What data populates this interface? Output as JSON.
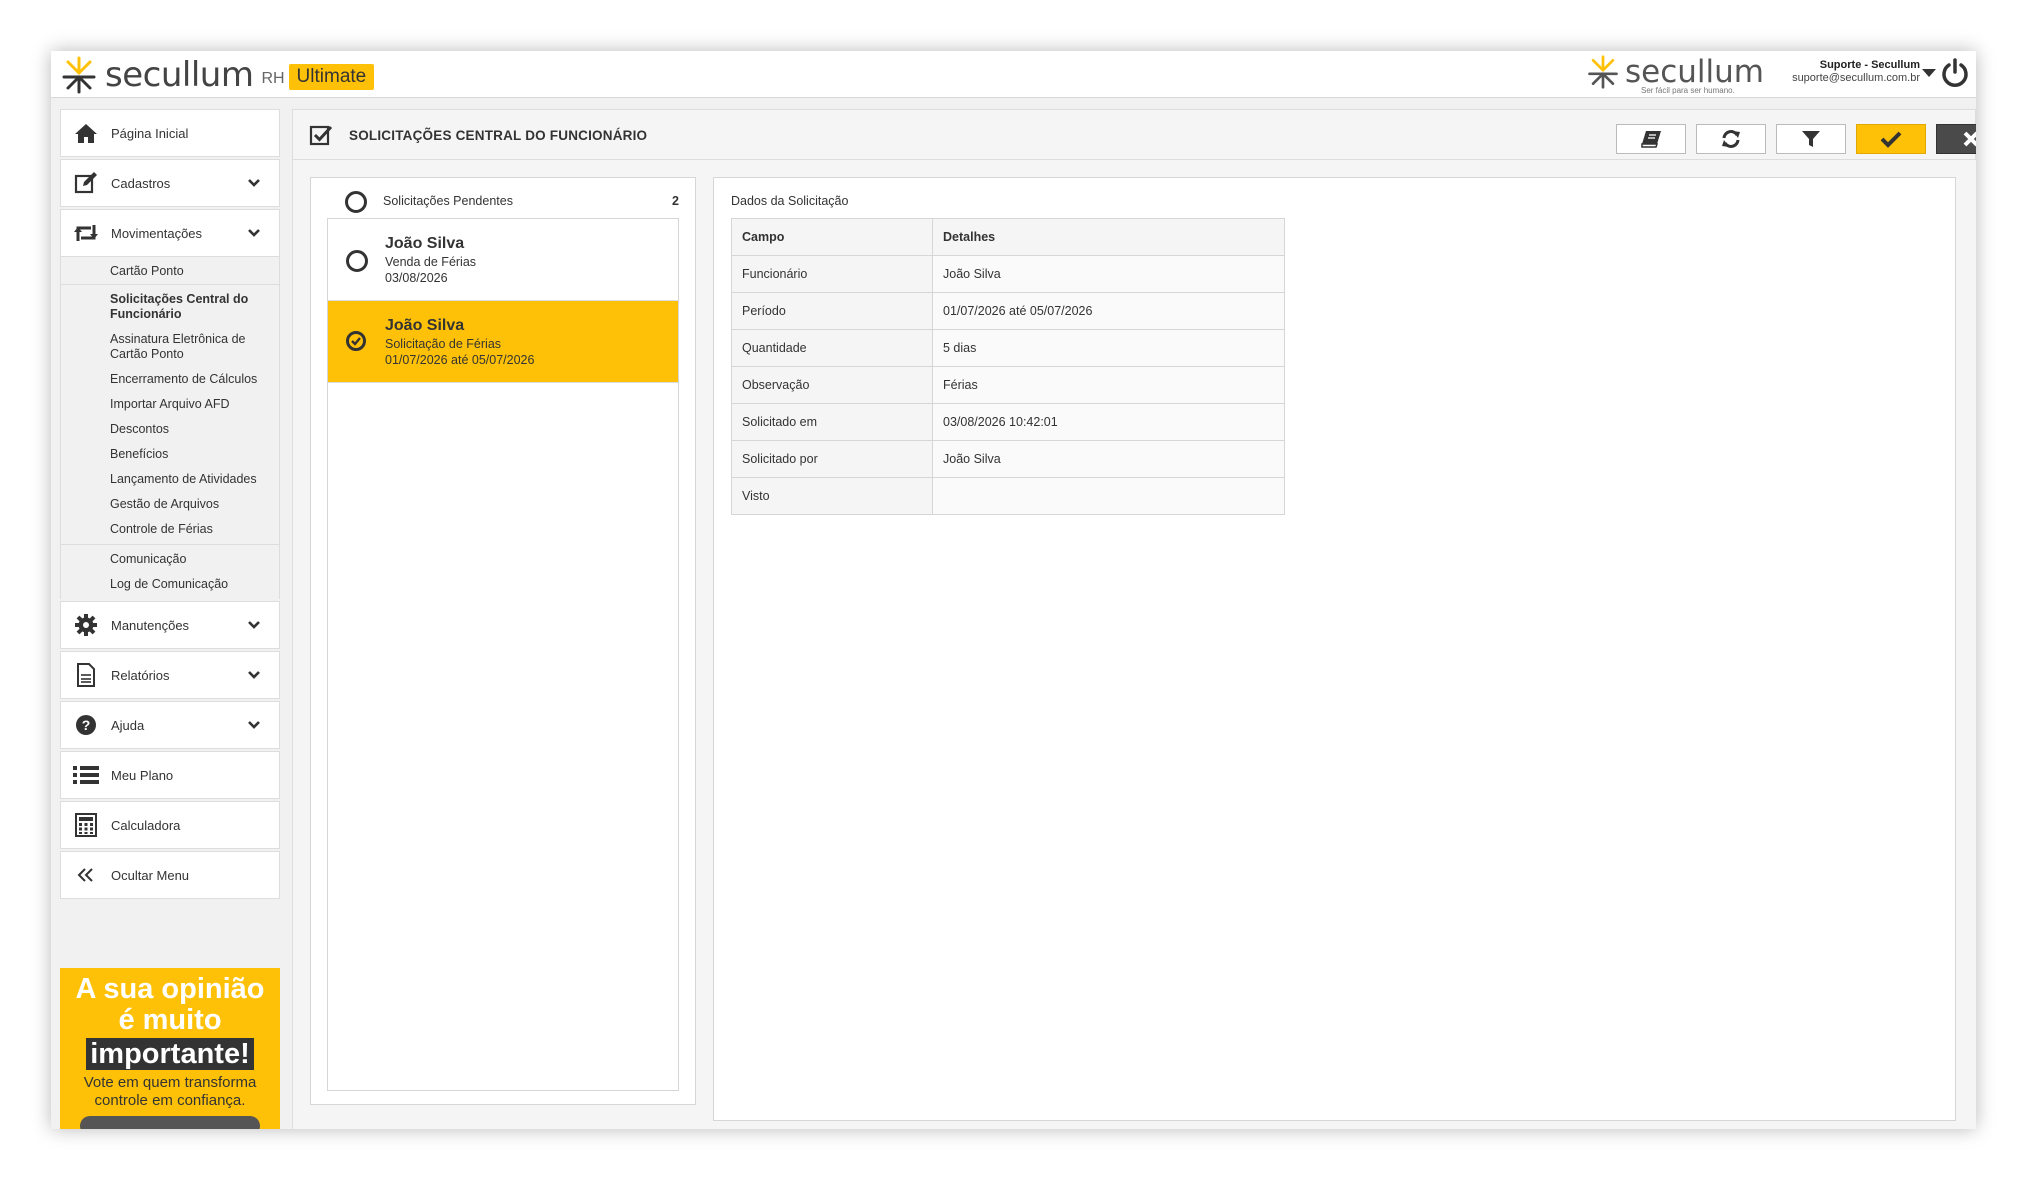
{
  "app": {
    "brand": "secullum",
    "product": "RH",
    "edition": "Ultimate",
    "tagline": "Ser fácil para ser humano."
  },
  "user": {
    "name": "Suporte - Secullum",
    "email": "suporte@secullum.com.br"
  },
  "sidebar": {
    "items": [
      {
        "label": "Página Inicial",
        "icon": "home-icon"
      },
      {
        "label": "Cadastros",
        "icon": "edit-icon"
      },
      {
        "label": "Movimentações",
        "icon": "retweet-icon"
      },
      {
        "label": "Manutenções",
        "icon": "gear-icon"
      },
      {
        "label": "Relatórios",
        "icon": "document-icon"
      },
      {
        "label": "Ajuda",
        "icon": "help-icon"
      },
      {
        "label": "Meu Plano",
        "icon": "list-icon"
      },
      {
        "label": "Calculadora",
        "icon": "calculator-icon"
      },
      {
        "label": "Ocultar Menu",
        "icon": "double-chevron-left-icon"
      }
    ],
    "submenu": [
      "Cartão Ponto",
      "Solicitações Central do Funcionário",
      "Assinatura Eletrônica de Cartão Ponto",
      "Encerramento de Cálculos",
      "Importar Arquivo AFD",
      "Descontos",
      "Benefícios",
      "Lançamento de Atividades",
      "Gestão de Arquivos",
      "Controle de Férias",
      "Comunicação",
      "Log de Comunicação"
    ]
  },
  "promo": {
    "line1": "A sua opinião",
    "line2": "é muito",
    "line3": "importante!",
    "line4": "Vote em quem transforma",
    "line5": "controle em confiança."
  },
  "page": {
    "title": "SOLICITAÇÕES CENTRAL DO FUNCIONÁRIO"
  },
  "toolbar": {
    "buttons": [
      "book-icon",
      "refresh-icon",
      "filter-icon",
      "check-icon",
      "close-icon"
    ],
    "approve_color": "#ffc107",
    "reject_color": "#4a4a4a"
  },
  "pending": {
    "label": "Solicitações Pendentes",
    "count": "2",
    "requests": [
      {
        "name": "João Silva",
        "type": "Venda de Férias",
        "detail": "03/08/2026",
        "selected": false
      },
      {
        "name": "João Silva",
        "type": "Solicitação de Férias",
        "detail": "01/07/2026 até 05/07/2026",
        "selected": true
      }
    ]
  },
  "details": {
    "title": "Dados da Solicitação",
    "col_field": "Campo",
    "col_details": "Detalhes",
    "rows": [
      {
        "field": "Funcionário",
        "value": "João Silva"
      },
      {
        "field": "Período",
        "value": "01/07/2026 até 05/07/2026"
      },
      {
        "field": "Quantidade",
        "value": "5 dias"
      },
      {
        "field": "Observação",
        "value": "Férias"
      },
      {
        "field": "Solicitado em",
        "value": "03/08/2026 10:42:01"
      },
      {
        "field": "Solicitado por",
        "value": "João Silva"
      },
      {
        "field": "Visto",
        "value": ""
      }
    ]
  },
  "colors": {
    "accent": "#ffc107",
    "dark": "#333333"
  }
}
